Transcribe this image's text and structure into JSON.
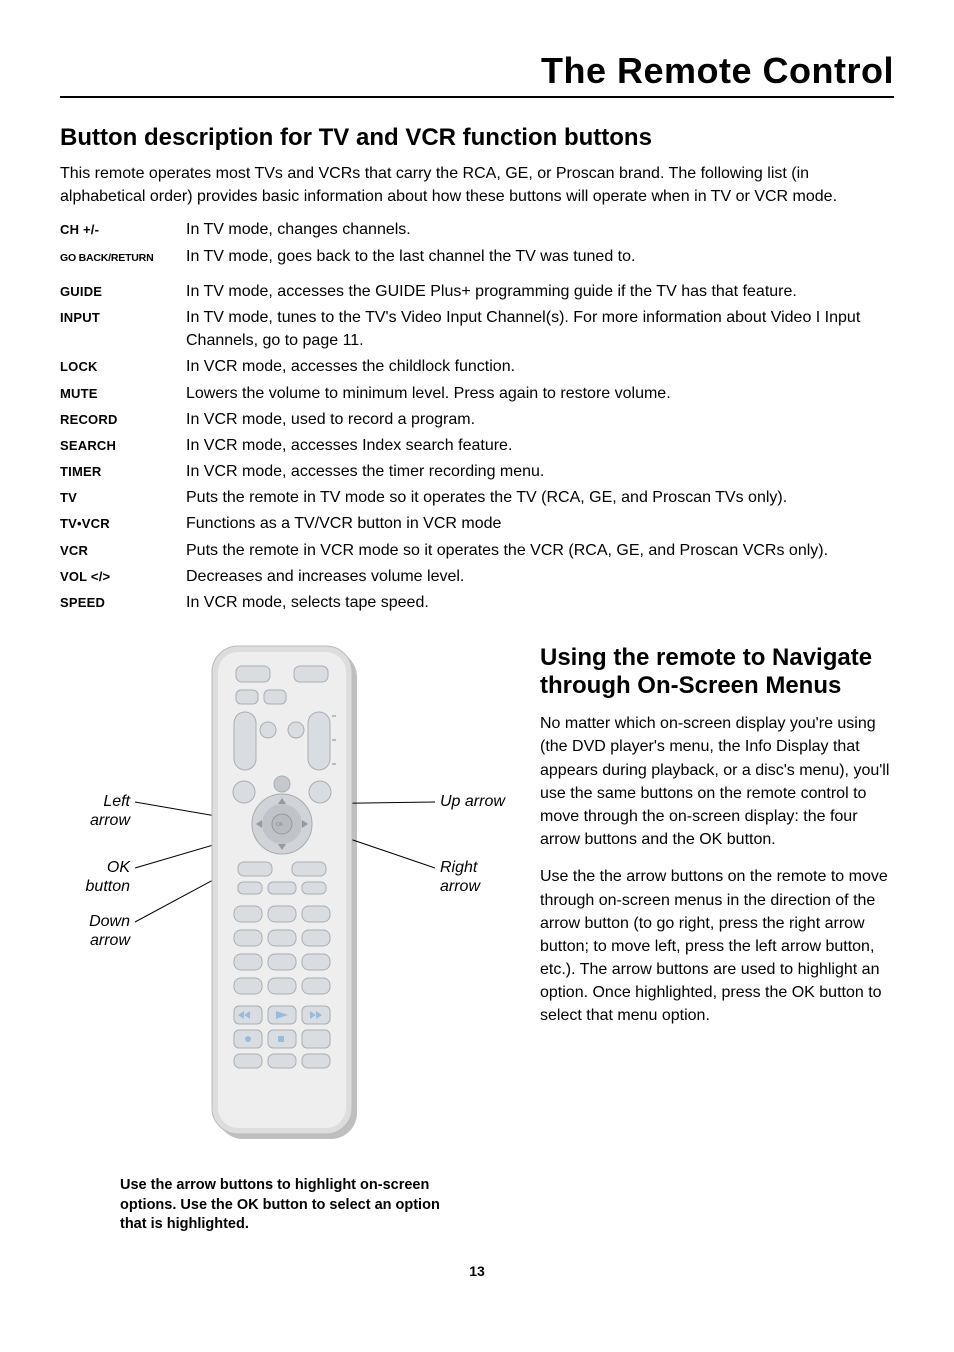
{
  "header": {
    "title": "The Remote Control"
  },
  "section1": {
    "title": "Button description for TV and VCR function buttons",
    "intro": "This remote operates most TVs and VCRs that carry the RCA, GE, or Proscan brand. The following list (in alphabetical order) provides basic information about how these buttons will operate when in TV or VCR mode."
  },
  "defs": [
    {
      "term": "CH +/-",
      "desc": "In TV mode, changes channels."
    },
    {
      "term": "GO BACK/RETURN",
      "small": true,
      "desc": "In TV mode, goes back to the last channel the TV was tuned to."
    },
    {
      "term": "GUIDE",
      "desc": "In TV mode, accesses the GUIDE Plus+ programming guide if the TV has that feature."
    },
    {
      "term": "INPUT",
      "desc": "In TV mode, tunes to the TV's Video Input Channel(s). For more information about Video I Input Channels, go to page 11."
    },
    {
      "term": "LOCK",
      "desc": "In VCR mode, accesses the childlock function."
    },
    {
      "term": "MUTE",
      "desc": "Lowers the volume to minimum level. Press again to restore volume."
    },
    {
      "term": "RECORD",
      "desc": "In VCR mode, used to record a program."
    },
    {
      "term": "SEARCH",
      "desc": "In VCR mode, accesses Index search feature."
    },
    {
      "term": "TIMER",
      "desc": "In VCR mode, accesses the timer recording menu."
    },
    {
      "term": "TV",
      "desc": "Puts the remote in TV mode so it operates the TV (RCA, GE, and Proscan TVs only)."
    },
    {
      "term": "TV•VCR",
      "desc": "Functions as a TV/VCR button in VCR mode"
    },
    {
      "term": "VCR",
      "desc": "Puts the remote in VCR mode so it operates the VCR (RCA, GE, and Proscan VCRs only)."
    },
    {
      "term": "VOL </>",
      "desc": "Decreases and increases volume level."
    },
    {
      "term": "SPEED",
      "desc": "In VCR mode, selects tape speed."
    }
  ],
  "section2": {
    "title": "Using the remote to Navigate through On-Screen Menus",
    "p1": "No matter which on-screen display you're using (the DVD player's menu, the Info Display that appears during playback, or a disc's menu), you'll use the same buttons on the remote control to move through the on-screen display: the four arrow buttons and the OK button.",
    "p2": "Use the the arrow buttons on the remote to move through on-screen menus in the direction of the arrow button (to go right, press the right arrow button; to move left, press the left arrow button, etc.). The arrow buttons are used to highlight an option. Once highlighted, press the OK button to select that menu option."
  },
  "figure": {
    "labels": {
      "left": "Left arrow",
      "ok": "OK button",
      "down": "Down arrow",
      "up": "Up arrow",
      "right": "Right arrow"
    },
    "caption": "Use the arrow buttons to highlight on-screen options. Use the OK button to select an option that is highlighted."
  },
  "page_number": "13"
}
